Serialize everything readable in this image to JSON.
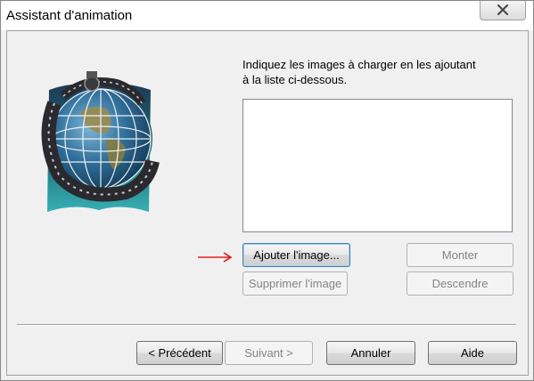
{
  "window": {
    "title": "Assistant d'animation"
  },
  "instructions": {
    "line1": "Indiquez les images à charger en les ajoutant",
    "line2": "à la liste ci-dessous."
  },
  "buttons": {
    "add_image": "Ajouter l'image...",
    "remove_image": "Supprimer l'image",
    "move_up": "Monter",
    "move_down": "Descendre",
    "previous": "< Précédent",
    "next": "Suivant >",
    "cancel": "Annuler",
    "help": "Aide"
  },
  "colors": {
    "annotation_arrow": "#e02020",
    "disabled_text": "#838383"
  },
  "icons": {
    "close": "close-icon",
    "logo": "globe-film-logo",
    "annotation": "red-arrow-annotation"
  }
}
